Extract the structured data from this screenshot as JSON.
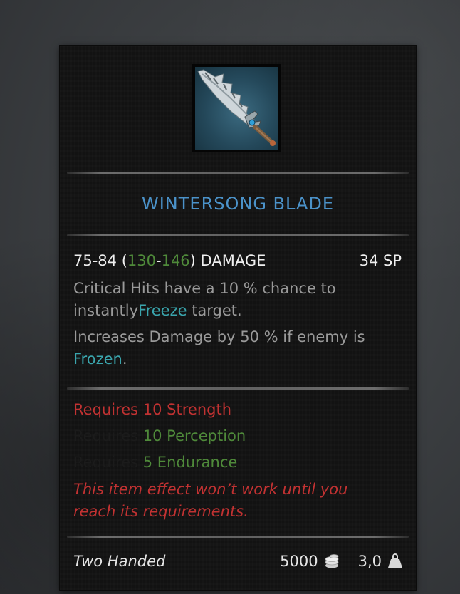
{
  "item": {
    "name": "WINTERSONG BLADE",
    "icon": "wintersong-blade-sword-icon",
    "damage_base": "75-84",
    "damage_bonus_low": "130",
    "damage_bonus_high": "146",
    "damage_label": "DAMAGE",
    "sp": "34 SP",
    "effects": {
      "crit_text": "Critical Hits have a 10 % chance to",
      "crit_text_2": "instantly",
      "crit_keyword": "Freeze",
      "crit_text_3": " target.",
      "dmg_text": "Increases Damage by 50 % if enemy is",
      "dmg_keyword": "Frozen",
      "dmg_text_end": "."
    },
    "requirements": [
      {
        "prefix": "Requires ",
        "value": "10 Strength"
      },
      {
        "prefix": "Requires ",
        "value": "10 Perception"
      },
      {
        "prefix": "Requires ",
        "value": "5 Endurance"
      }
    ],
    "warning_line_1": "This item effect won’t work until you",
    "warning_line_2": "reach its requirements.",
    "handedness": "Two Handed",
    "price": "5000",
    "weight": "3,0"
  },
  "colors": {
    "title_blue": "#4b92c9",
    "bonus_green": "#4f8a3a",
    "keyword_teal": "#3aa5ad",
    "requirement_red": "#c23232",
    "panel_bg": "#121212"
  }
}
